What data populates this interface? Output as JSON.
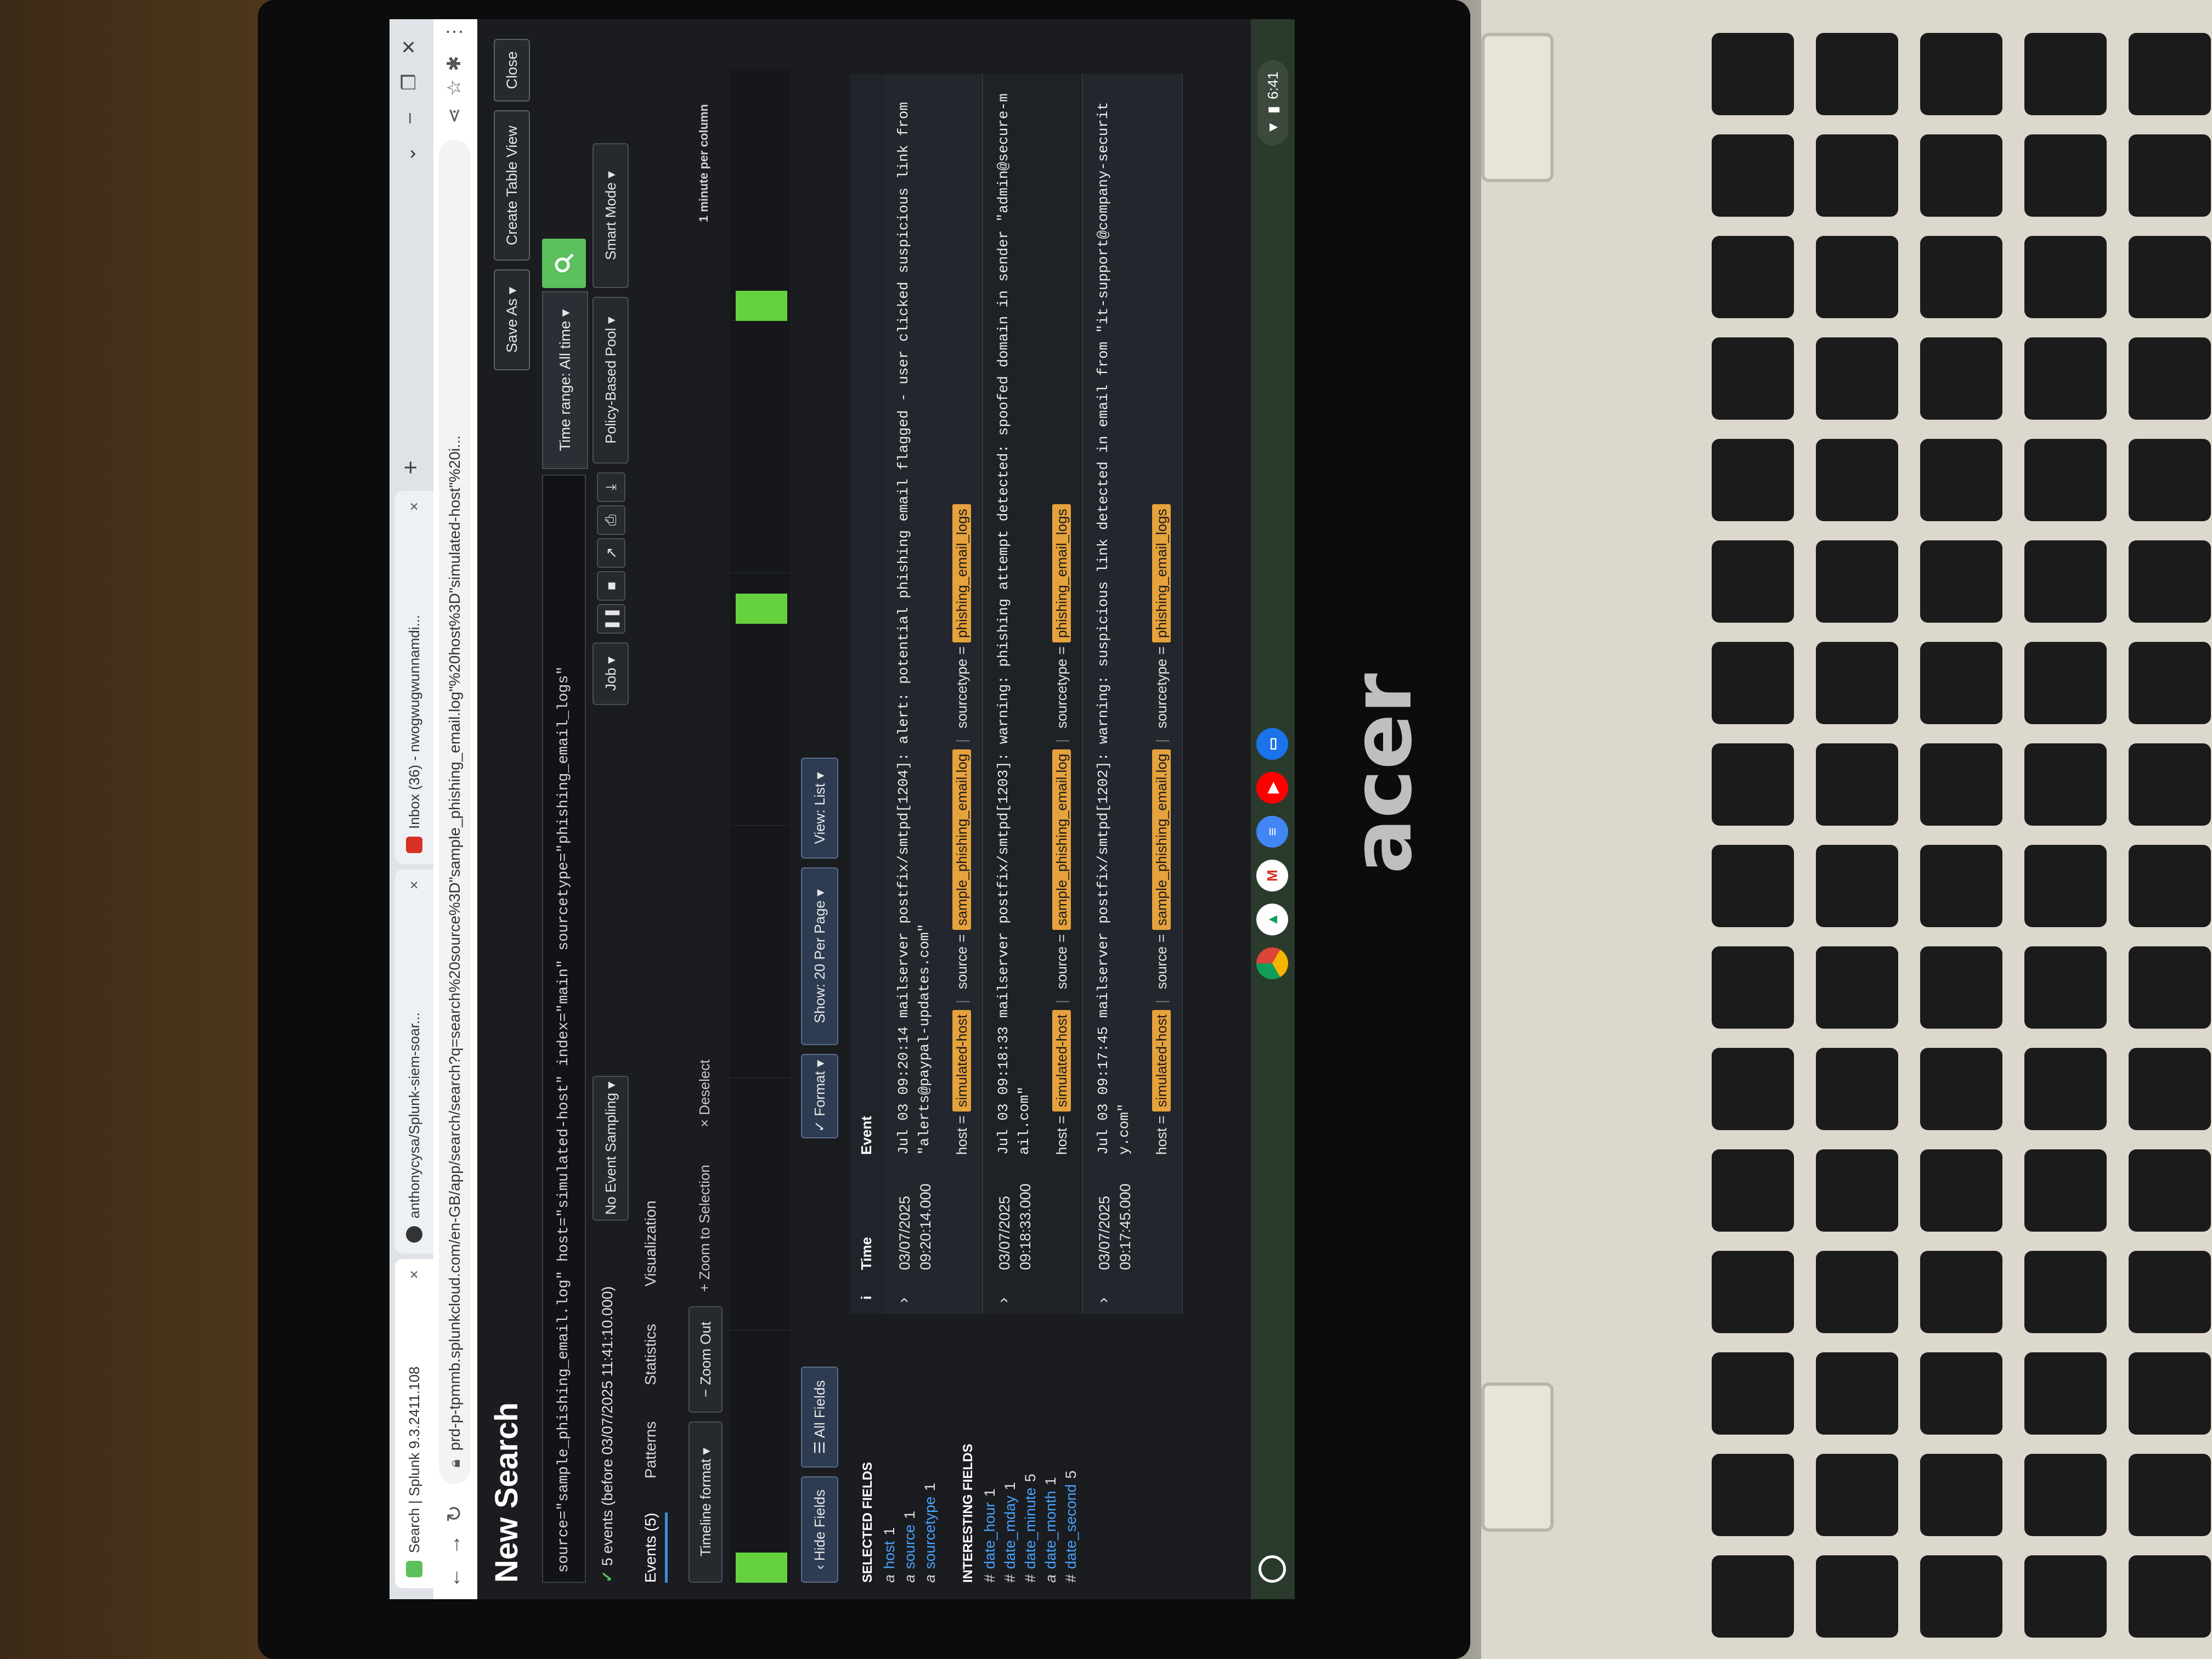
{
  "browser": {
    "tabs": [
      {
        "label": "Search | Splunk 9.3.2411.108",
        "icon": "splunk-icon",
        "active": true
      },
      {
        "label": "anthonycysa/Splunk-siem-soar...",
        "icon": "github-icon",
        "active": false
      },
      {
        "label": "Inbox (36) - nwogwugwunnamdi...",
        "icon": "gmail-icon",
        "active": false
      }
    ],
    "url": "prd-p-tpmmb.splunkcloud.com/en-GB/app/search/search?q=search%20source%3D\"sample_phishing_email.log\"%20host%3D\"simulated-host\"%20i..."
  },
  "header": {
    "title": "New Search",
    "save_as": "Save As ▾",
    "create_table_view": "Create Table View",
    "close": "Close"
  },
  "search": {
    "query": "source=\"sample_phishing_email.log\" host=\"simulated-host\" index=\"main\" sourcetype=\"phishing_email_logs\"",
    "time_range": "Time range: All time ▾"
  },
  "status": {
    "summary": "5 events (before 03/07/2025 11:41:10.000)",
    "sampling": "No Event Sampling ▾",
    "job": "Job ▾",
    "pool": "Policy-Based Pool ▾",
    "mode": "Smart Mode ▾"
  },
  "tabs": [
    "Events (5)",
    "Patterns",
    "Statistics",
    "Visualization"
  ],
  "timeline_controls": {
    "format": "Timeline format ▾",
    "zoom_out": "− Zoom Out",
    "zoom_selection": "+ Zoom to Selection",
    "deselect": "× Deselect",
    "per_column": "1 minute per column"
  },
  "timeline_bars": [
    {
      "column": 0,
      "count": 1
    },
    {
      "column": 57,
      "count": 1
    },
    {
      "column": 75,
      "count": 1
    }
  ],
  "list_controls": {
    "hide_fields": "‹ Hide Fields",
    "all_fields": "☰ All Fields",
    "format": "✓ Format ▾",
    "per_page": "Show: 20 Per Page ▾",
    "view": "View: List ▾"
  },
  "sidebar": {
    "selected_heading": "SELECTED FIELDS",
    "selected": [
      {
        "type": "a",
        "name": "host",
        "count": "1"
      },
      {
        "type": "a",
        "name": "source",
        "count": "1"
      },
      {
        "type": "a",
        "name": "sourcetype",
        "count": "1"
      }
    ],
    "interesting_heading": "INTERESTING FIELDS",
    "interesting": [
      {
        "type": "#",
        "name": "date_hour",
        "count": "1"
      },
      {
        "type": "#",
        "name": "date_mday",
        "count": "1"
      },
      {
        "type": "#",
        "name": "date_minute",
        "count": "5"
      },
      {
        "type": "a",
        "name": "date_month",
        "count": "1"
      },
      {
        "type": "#",
        "name": "date_second",
        "count": "5"
      }
    ]
  },
  "events_table": {
    "col_info": "i",
    "col_time": "Time",
    "col_event": "Event",
    "rows": [
      {
        "date": "03/07/2025",
        "time": "09:20:14.000",
        "text": "Jul 03 09:20:14 mailserver postfix/smtpd[1204]: alert: potential phishing email flagged - user clicked suspicious link from \"alerts@paypal-updates.com\"",
        "host": "simulated-host",
        "source": "sample_phishing_email.log",
        "sourcetype": "phishing_email_logs"
      },
      {
        "date": "03/07/2025",
        "time": "09:18:33.000",
        "text": "Jul 03 09:18:33 mailserver postfix/smtpd[1203]: warning: phishing attempt detected: spoofed domain in sender \"admin@secure-mail.com\"",
        "host": "simulated-host",
        "source": "sample_phishing_email.log",
        "sourcetype": "phishing_email_logs"
      },
      {
        "date": "03/07/2025",
        "time": "09:17:45.000",
        "text": "Jul 03 09:17:45 mailserver postfix/smtpd[1202]: warning: suspicious link detected in email from \"it-support@company-security.com\"",
        "host": "simulated-host",
        "source": "sample_phishing_email.log",
        "sourcetype": "phishing_email_logs"
      }
    ]
  },
  "field_labels": {
    "host": "host =",
    "source": "source =",
    "sourcetype": "sourcetype ="
  },
  "shelf": {
    "apps": [
      "chrome-icon",
      "drive-icon",
      "gmail-icon",
      "docs-icon",
      "youtube-icon",
      "files-icon"
    ],
    "clock": "6:41"
  },
  "device": {
    "brand": "acer"
  },
  "colors": {
    "accent_green": "#65d13f",
    "tag_yellow": "#e6a23c",
    "link_blue": "#4aa3ff"
  }
}
